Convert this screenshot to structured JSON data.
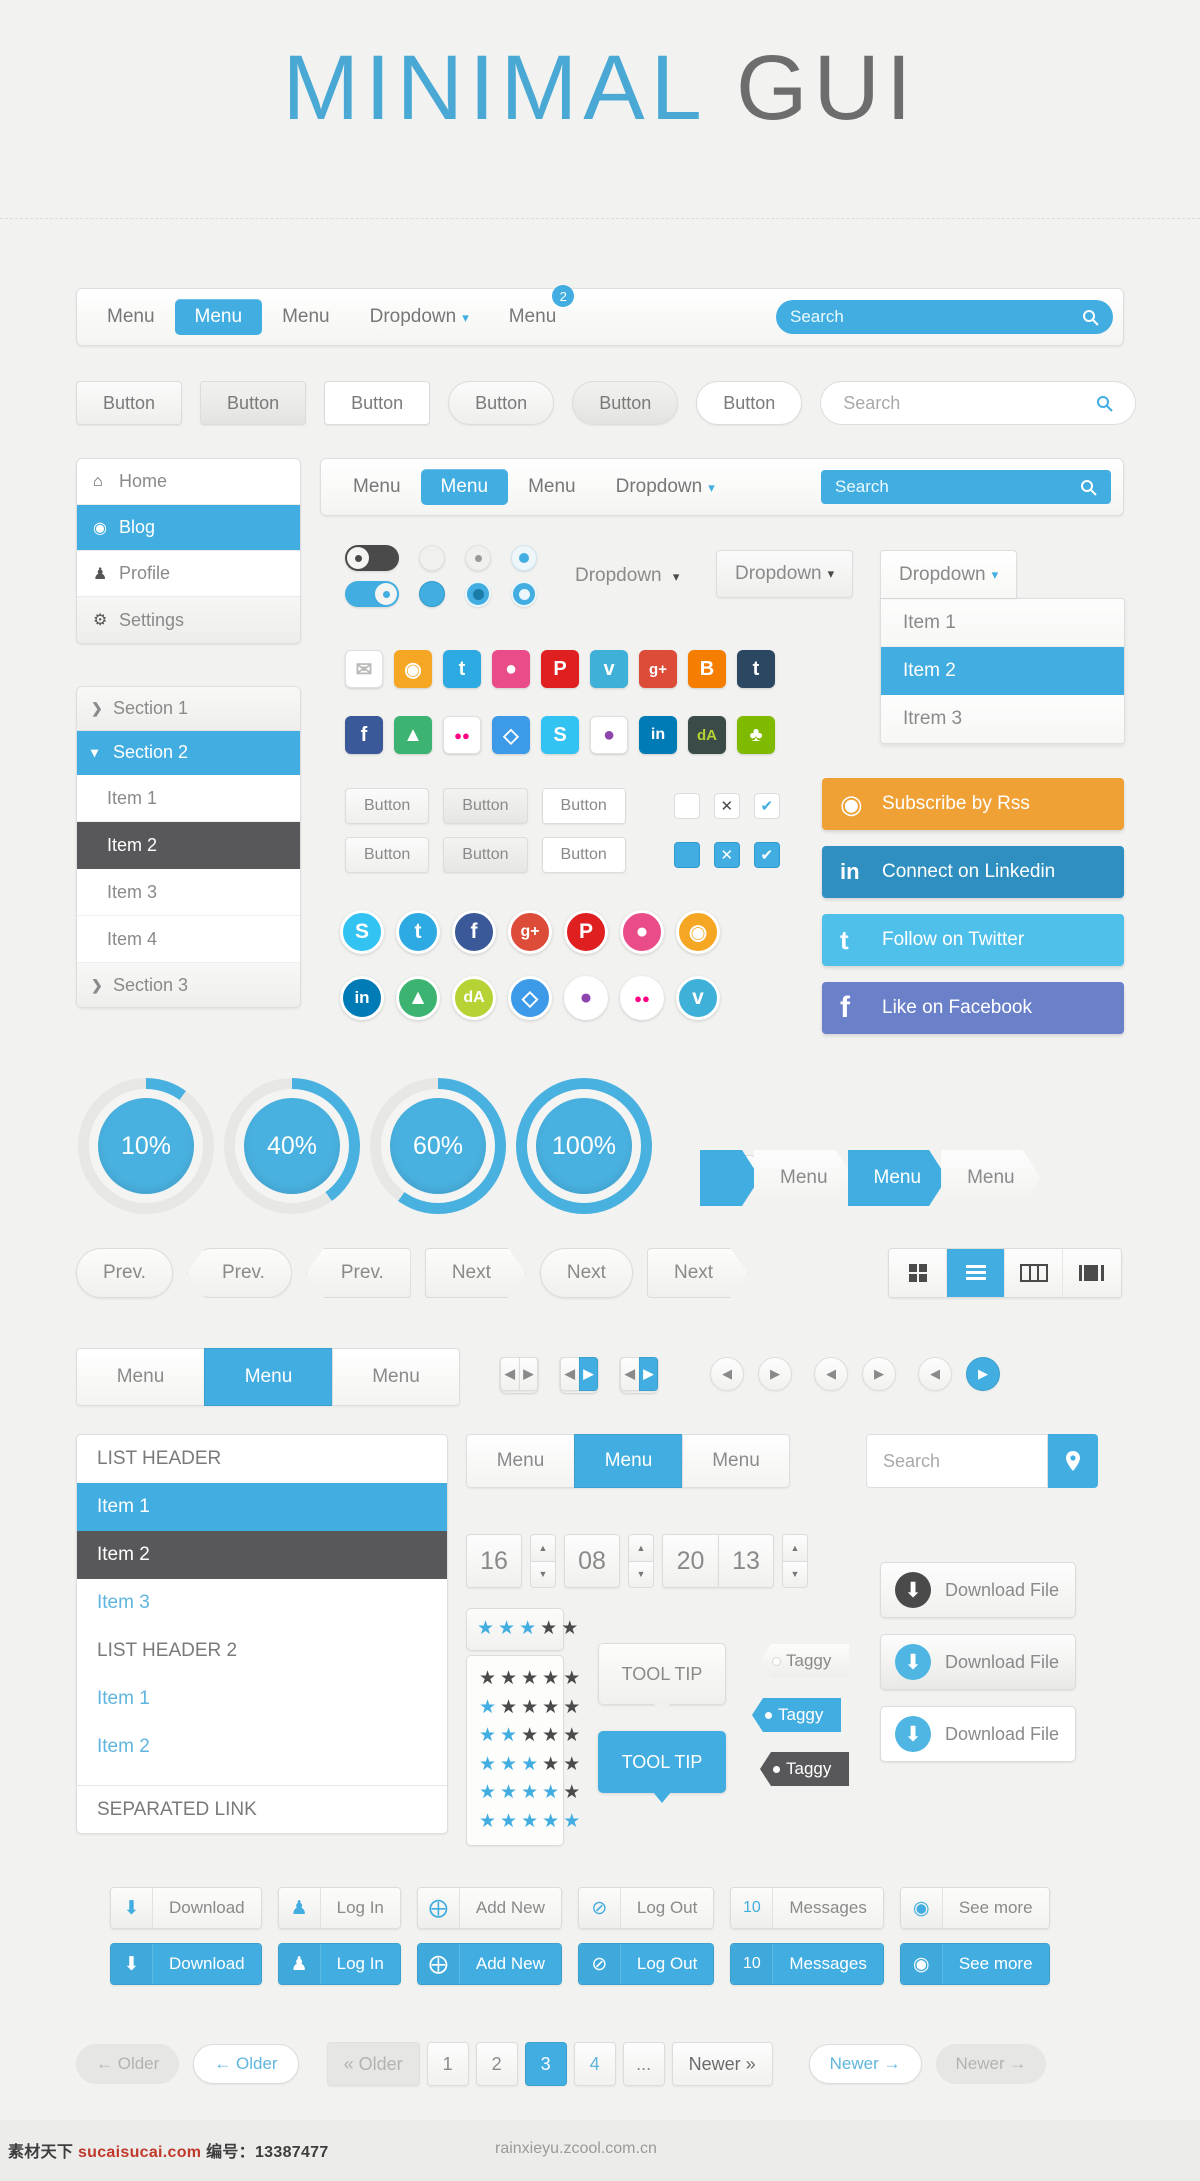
{
  "hero": {
    "word1": "MINIMAL",
    "word2": "GUI"
  },
  "topnav": {
    "items": [
      {
        "label": "Menu",
        "state": "default"
      },
      {
        "label": "Menu",
        "state": "active"
      },
      {
        "label": "Menu",
        "state": "default"
      },
      {
        "label": "Dropdown",
        "state": "dropdown",
        "caret": "⌄"
      },
      {
        "label": "Menu",
        "state": "badge",
        "badge": "2"
      }
    ],
    "search_placeholder": "Search",
    "search_icon": "search-icon"
  },
  "buttons_row": {
    "labels": [
      "Button",
      "Button",
      "Button",
      "Button",
      "Button",
      "Button"
    ],
    "search_placeholder": "Search"
  },
  "vmenu": {
    "items": [
      {
        "label": "Home",
        "icon": "home-icon",
        "glyph": "⌂",
        "active": false
      },
      {
        "label": "Blog",
        "icon": "disc-icon",
        "glyph": "◉",
        "active": true
      },
      {
        "label": "Profile",
        "icon": "user-icon",
        "glyph": "♟",
        "active": false
      },
      {
        "label": "Settings",
        "icon": "gear-icon",
        "glyph": "⚙",
        "active": false
      }
    ]
  },
  "accordion": {
    "sections": [
      {
        "label": "Section 1",
        "chevron": "❯",
        "open": false
      },
      {
        "label": "Section 2",
        "chevron": "⌄",
        "open": true
      }
    ],
    "items": [
      {
        "label": "Item 1",
        "selected": false
      },
      {
        "label": "Item 2",
        "selected": true
      },
      {
        "label": "Item 3",
        "selected": false
      },
      {
        "label": "Item 4",
        "selected": false
      }
    ],
    "section3": {
      "label": "Section 3",
      "chevron": "❯"
    }
  },
  "nav2": {
    "items": [
      {
        "label": "Menu",
        "state": "default"
      },
      {
        "label": "Menu",
        "state": "active"
      },
      {
        "label": "Menu",
        "state": "default"
      },
      {
        "label": "Dropdown",
        "state": "dropdown",
        "caret": "⌄"
      }
    ],
    "search_placeholder": "Search"
  },
  "dropdowns": {
    "inline_label": "Dropdown",
    "caret": "⌄",
    "button_label": "Dropdown",
    "open_label": "Dropdown",
    "items": [
      {
        "label": "Item 1",
        "selected": false
      },
      {
        "label": "Item 2",
        "selected": true
      },
      {
        "label": "Itrem 3",
        "selected": false
      }
    ]
  },
  "social_squares_row1": [
    {
      "name": "email-icon",
      "glyph": "✉",
      "color": "#ffffff",
      "fg": "#d8d8d6"
    },
    {
      "name": "rss-icon",
      "glyph": "◔",
      "color": "#f5a623",
      "fg": "#ffffff"
    },
    {
      "name": "twitter-icon",
      "glyph": "t",
      "color": "#2daae1",
      "fg": "#ffffff"
    },
    {
      "name": "dribbble-icon",
      "glyph": "●",
      "color": "#ea4c89",
      "fg": "#ffffff"
    },
    {
      "name": "pinterest-icon",
      "glyph": "P",
      "color": "#e02020",
      "fg": "#ffffff"
    },
    {
      "name": "vimeo-icon",
      "glyph": "v",
      "color": "#3fb0d8",
      "fg": "#ffffff"
    },
    {
      "name": "googleplus-icon",
      "glyph": "g+",
      "color": "#dd4b39",
      "fg": "#ffffff"
    },
    {
      "name": "blogger-icon",
      "glyph": "B",
      "color": "#f57d00",
      "fg": "#ffffff"
    },
    {
      "name": "tumblr-icon",
      "glyph": "t",
      "color": "#2c4762",
      "fg": "#ffffff"
    }
  ],
  "social_squares_row2": [
    {
      "name": "facebook-icon",
      "glyph": "f",
      "color": "#3b5998",
      "fg": "#ffffff"
    },
    {
      "name": "evernote-icon",
      "glyph": "▲",
      "color": "#3cb371",
      "fg": "#ffffff"
    },
    {
      "name": "flickr-icon",
      "glyph": "●●",
      "color": "#ffffff",
      "fg": "#ff0084"
    },
    {
      "name": "dropbox-icon",
      "glyph": "◇",
      "color": "#3d9ae8",
      "fg": "#ffffff"
    },
    {
      "name": "skype-icon",
      "glyph": "S",
      "color": "#32c3f3",
      "fg": "#ffffff"
    },
    {
      "name": "picasa-icon",
      "glyph": "●",
      "color": "#ffffff",
      "fg": "#8e44ad"
    },
    {
      "name": "linkedin-icon",
      "glyph": "in",
      "color": "#007bb6",
      "fg": "#ffffff"
    },
    {
      "name": "deviantart-icon",
      "glyph": "dA",
      "color": "#3b4b48",
      "fg": "#b5d334"
    },
    {
      "name": "forrst-icon",
      "glyph": "♣",
      "color": "#7fba00",
      "fg": "#ffffff"
    }
  ],
  "social_circles_row1": [
    {
      "name": "skype-icon",
      "glyph": "S",
      "color": "#32c3f3"
    },
    {
      "name": "twitter-icon",
      "glyph": "t",
      "color": "#2daae1"
    },
    {
      "name": "facebook-icon",
      "glyph": "f",
      "color": "#3b5998"
    },
    {
      "name": "googleplus-icon",
      "glyph": "g+",
      "color": "#dd4b39"
    },
    {
      "name": "pinterest-icon",
      "glyph": "P",
      "color": "#e02020"
    },
    {
      "name": "dribbble-icon",
      "glyph": "●",
      "color": "#ea4c89"
    },
    {
      "name": "rss-icon",
      "glyph": "◔",
      "color": "#f5a623"
    }
  ],
  "social_circles_row2": [
    {
      "name": "linkedin-icon",
      "glyph": "in",
      "color": "#007bb6"
    },
    {
      "name": "evernote-icon",
      "glyph": "▲",
      "color": "#3cb371"
    },
    {
      "name": "deviantart-icon",
      "glyph": "dA",
      "color": "#b5d334"
    },
    {
      "name": "dropbox-icon",
      "glyph": "◇",
      "color": "#3d9ae8"
    },
    {
      "name": "picasa-icon",
      "glyph": "●",
      "color": "#ffffff"
    },
    {
      "name": "flickr-icon",
      "glyph": "●●",
      "color": "#ffffff"
    },
    {
      "name": "vimeo-icon",
      "glyph": "v",
      "color": "#3fb0d8"
    }
  ],
  "mini_buttons": {
    "row1": [
      "Button",
      "Button",
      "Button"
    ],
    "row2": [
      "Button",
      "Button",
      "Button"
    ],
    "check_x": "✕",
    "check_v": "✔"
  },
  "social_buttons": [
    {
      "label": "Subscribe by Rss",
      "icon": "rss-icon",
      "glyph": "◔",
      "color": "#f0a135"
    },
    {
      "label": "Connect on Linkedin",
      "icon": "linkedin-icon",
      "glyph": "in",
      "color": "#2e8fc0"
    },
    {
      "label": "Follow on Twitter",
      "icon": "twitter-icon",
      "glyph": "t",
      "color": "#4ec0ea"
    },
    {
      "label": "Like on Facebook",
      "icon": "facebook-icon",
      "glyph": "f",
      "color": "#6a80c8"
    }
  ],
  "progress": [
    {
      "label": "10%",
      "value": 10
    },
    {
      "label": "40%",
      "value": 40
    },
    {
      "label": "60%",
      "value": 60
    },
    {
      "label": "100%",
      "value": 100
    }
  ],
  "stepper": {
    "minus": "−",
    "plus": "+",
    "close": "✕"
  },
  "crumbs": [
    {
      "label": "",
      "active": true,
      "head": true
    },
    {
      "label": "Menu",
      "active": false
    },
    {
      "label": "Menu",
      "active": true
    },
    {
      "label": "Menu",
      "active": false
    }
  ],
  "prevnext": {
    "prev": [
      "Prev.",
      "Prev.",
      "Prev."
    ],
    "next": [
      "Next",
      "Next",
      "Next"
    ]
  },
  "viewtabs": [
    {
      "name": "grid-view-icon",
      "active": false
    },
    {
      "name": "list-view-icon",
      "active": true
    },
    {
      "name": "column-view-icon",
      "active": false
    },
    {
      "name": "detail-view-icon",
      "active": false
    }
  ],
  "tabrow": [
    {
      "label": "Menu",
      "active": false
    },
    {
      "label": "Menu",
      "active": true
    },
    {
      "label": "Menu",
      "active": false
    }
  ],
  "pagers": {
    "left_arrow": "◀",
    "right_arrow": "▶"
  },
  "listpanel": {
    "header1": "LIST HEADER",
    "items1": [
      {
        "label": "Item 1",
        "state": "active"
      },
      {
        "label": "Item 2",
        "state": "dark"
      },
      {
        "label": "Item 3",
        "state": "link"
      }
    ],
    "header2": "LIST HEADER 2",
    "items2": [
      {
        "label": "Item 1",
        "state": "link"
      },
      {
        "label": "Item 2",
        "state": "link"
      }
    ],
    "separated": "SEPARATED LINK"
  },
  "midtabs": [
    {
      "label": "Menu",
      "active": false
    },
    {
      "label": "Menu",
      "active": true
    },
    {
      "label": "Menu",
      "active": false
    }
  ],
  "midsearch": {
    "placeholder": "Search",
    "button_icon": "location-pin-icon",
    "glyph": "⚲"
  },
  "spinner": {
    "values": [
      "16",
      "08",
      "20",
      "13"
    ],
    "up": "▲",
    "down": "▼"
  },
  "stars": {
    "top_row": [
      1,
      1,
      1,
      0,
      0
    ],
    "grid": [
      [
        0,
        0,
        0,
        0,
        0
      ],
      [
        1,
        0,
        0,
        0,
        0
      ],
      [
        1,
        1,
        0,
        0,
        0
      ],
      [
        1,
        1,
        1,
        0,
        0
      ],
      [
        1,
        1,
        1,
        1,
        0
      ],
      [
        1,
        1,
        1,
        1,
        1
      ]
    ],
    "glyph": "★"
  },
  "tooltips": [
    {
      "label": "TOOL TIP",
      "style": "light"
    },
    {
      "label": "TOOL TIP",
      "style": "blue"
    }
  ],
  "taggy": [
    {
      "label": "Taggy",
      "style": "light"
    },
    {
      "label": "Taggy",
      "style": "blue"
    },
    {
      "label": "Taggy",
      "style": "dark"
    }
  ],
  "download_buttons": [
    {
      "label": "Download File",
      "icon": "download-icon",
      "glyph": "↓",
      "color": "#4a4a4a"
    },
    {
      "label": "Download File",
      "icon": "download-icon",
      "glyph": "↓",
      "color": "#4fb5e3"
    },
    {
      "label": "Download File",
      "icon": "download-icon",
      "glyph": "↓",
      "color": "#4fb5e3"
    }
  ],
  "actions": [
    {
      "label": "Download",
      "icon": "download-icon",
      "glyph": "↓"
    },
    {
      "label": "Log In",
      "icon": "user-icon",
      "glyph": "♟"
    },
    {
      "label": "Add New",
      "icon": "plus-circle-icon",
      "glyph": "⊕"
    },
    {
      "label": "Log Out",
      "icon": "logout-icon",
      "glyph": "⊘"
    },
    {
      "label": "Messages",
      "icon": "count-badge",
      "glyph": "10"
    },
    {
      "label": "See more",
      "icon": "eye-icon",
      "glyph": "◉"
    }
  ],
  "pagination": {
    "older_disabled": "← Older",
    "older_active": "← Older",
    "older_chev": "« Older",
    "numbers": [
      {
        "label": "1",
        "state": "default"
      },
      {
        "label": "2",
        "state": "default"
      },
      {
        "label": "3",
        "state": "active"
      },
      {
        "label": "4",
        "state": "link"
      },
      {
        "label": "...",
        "state": "default"
      },
      {
        "label": "Newer »",
        "state": "wide"
      }
    ],
    "newer_active": "Newer →",
    "newer_disabled": "Newer →"
  },
  "footer": {
    "left_cn": "素材天下",
    "left_site": "sucaisucai.com",
    "left_num_label": "编号：",
    "left_num": "13387477",
    "right": "rainxieyu.zcool.com.cn"
  },
  "colors": {
    "accent": "#42ade0",
    "dark": "#58585a",
    "bg": "#f2f2f0"
  }
}
